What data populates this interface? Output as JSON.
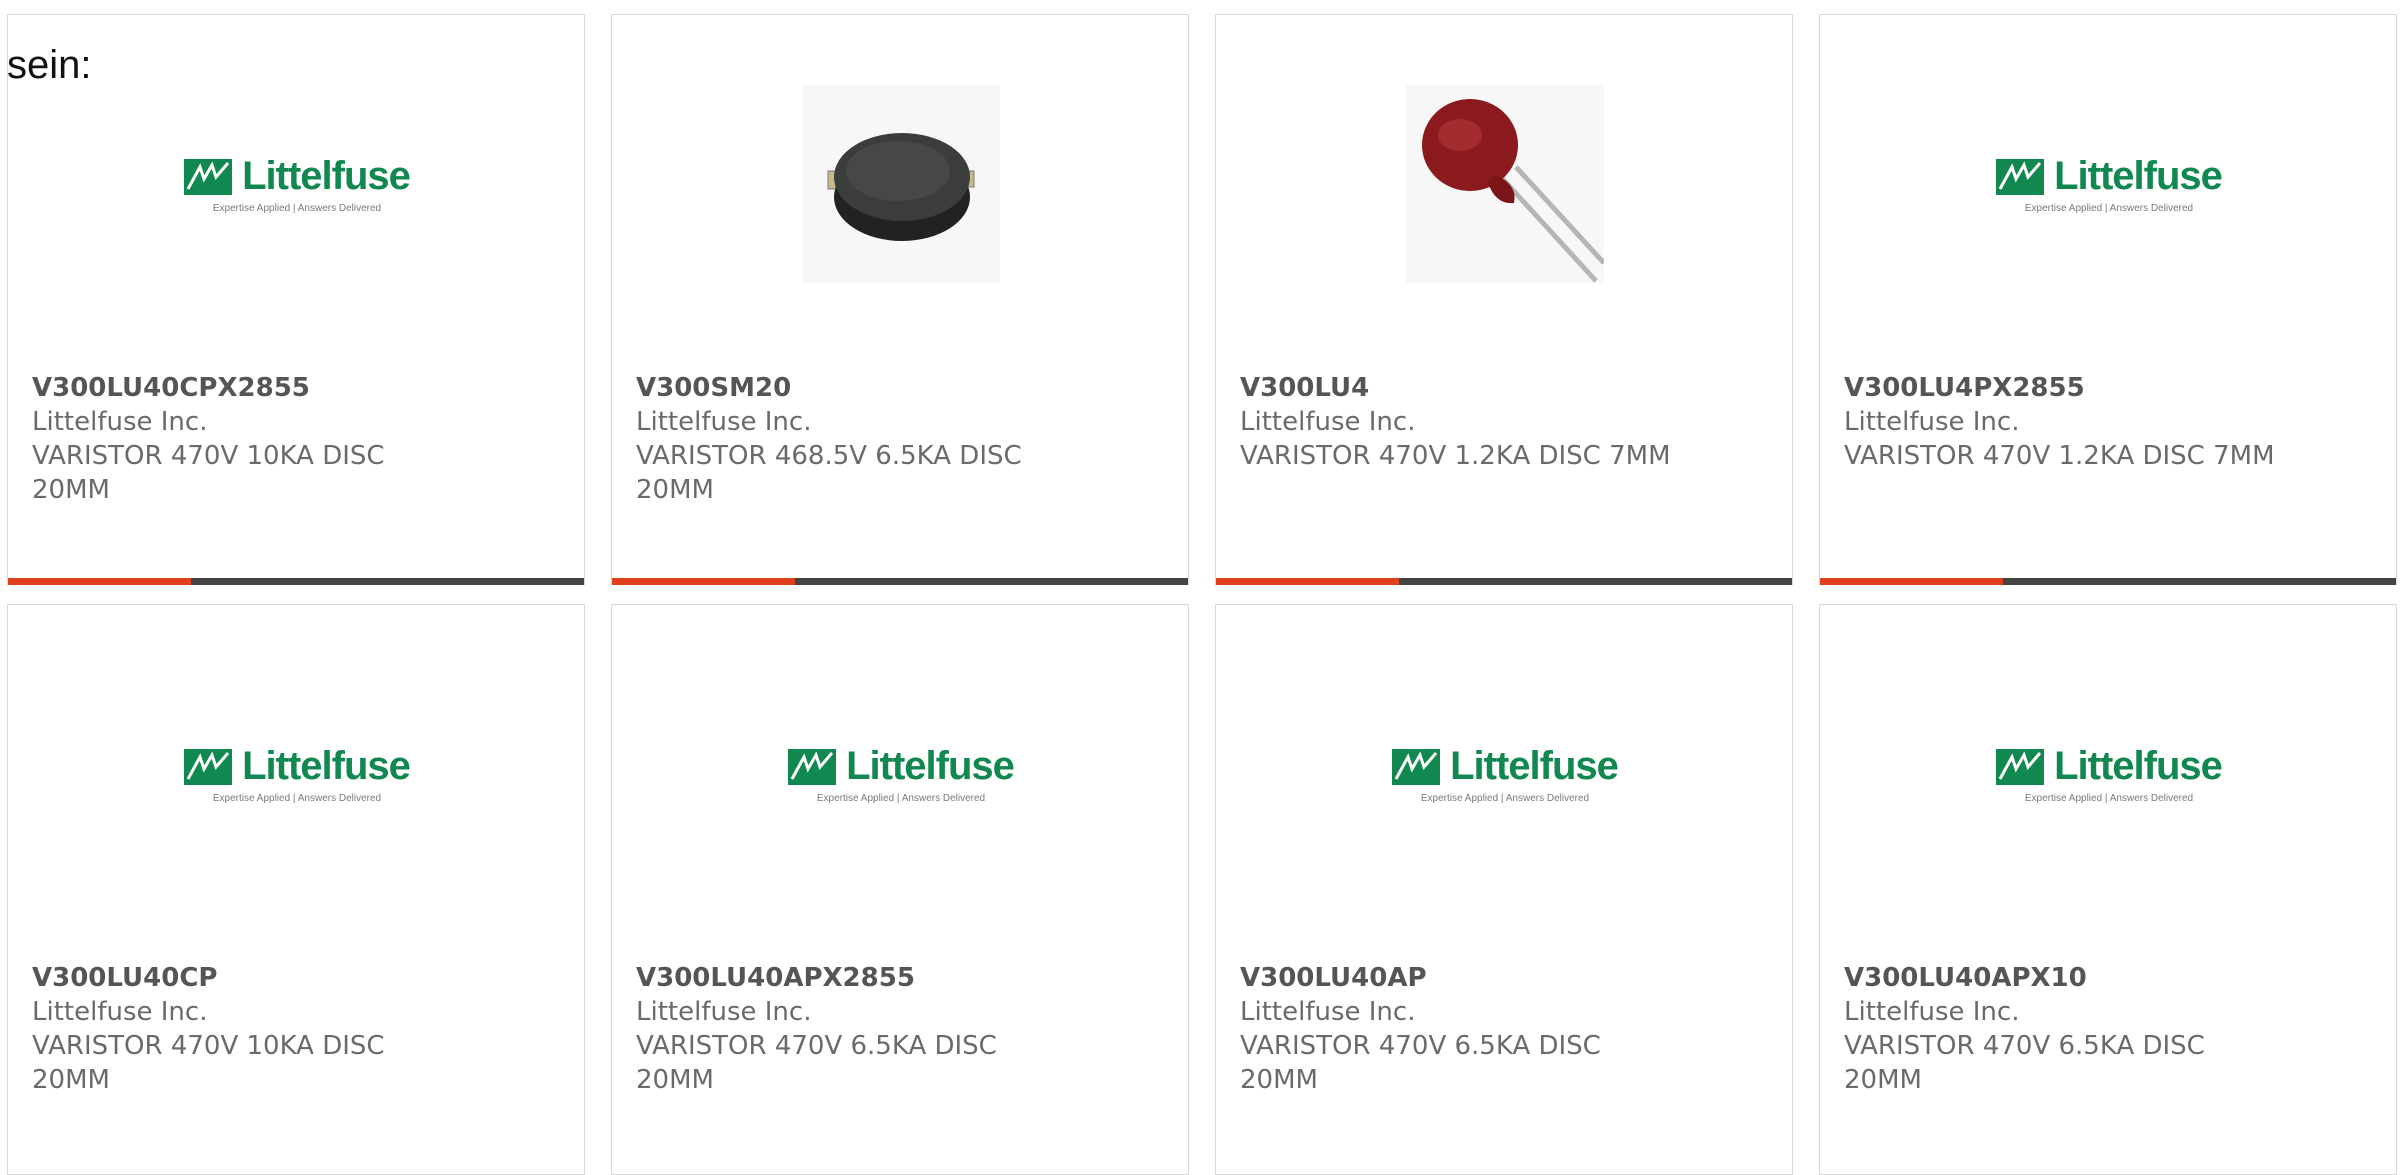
{
  "intro_text": "sein:",
  "colors": {
    "accent": "#e0401b",
    "bar": "#444444",
    "logo": "#11884f"
  },
  "logo": {
    "word": "Littelfuse",
    "tagline": "Expertise Applied | Answers Delivered"
  },
  "products": [
    {
      "part_number": "V300LU40CPX2855",
      "manufacturer": "Littelfuse Inc.",
      "description": "VARISTOR 470V 10KA DISC 20MM",
      "image": "logo"
    },
    {
      "part_number": "V300SM20",
      "manufacturer": "Littelfuse Inc.",
      "description": "VARISTOR 468.5V 6.5KA DISC 20MM",
      "image": "disk-component-photo"
    },
    {
      "part_number": "V300LU4",
      "manufacturer": "Littelfuse Inc.",
      "description": "VARISTOR 470V 1.2KA DISC 7MM",
      "image": "radial-varistor-photo"
    },
    {
      "part_number": "V300LU4PX2855",
      "manufacturer": "Littelfuse Inc.",
      "description": "VARISTOR 470V 1.2KA DISC 7MM",
      "image": "logo"
    },
    {
      "part_number": "V300LU40CP",
      "manufacturer": "Littelfuse Inc.",
      "description": "VARISTOR 470V 10KA DISC 20MM",
      "image": "logo"
    },
    {
      "part_number": "V300LU40APX2855",
      "manufacturer": "Littelfuse Inc.",
      "description": "VARISTOR 470V 6.5KA DISC 20MM",
      "image": "logo"
    },
    {
      "part_number": "V300LU40AP",
      "manufacturer": "Littelfuse Inc.",
      "description": "VARISTOR 470V 6.5KA DISC 20MM",
      "image": "logo"
    },
    {
      "part_number": "V300LU40APX10",
      "manufacturer": "Littelfuse Inc.",
      "description": "VARISTOR 470V 6.5KA DISC 20MM",
      "image": "logo"
    }
  ]
}
